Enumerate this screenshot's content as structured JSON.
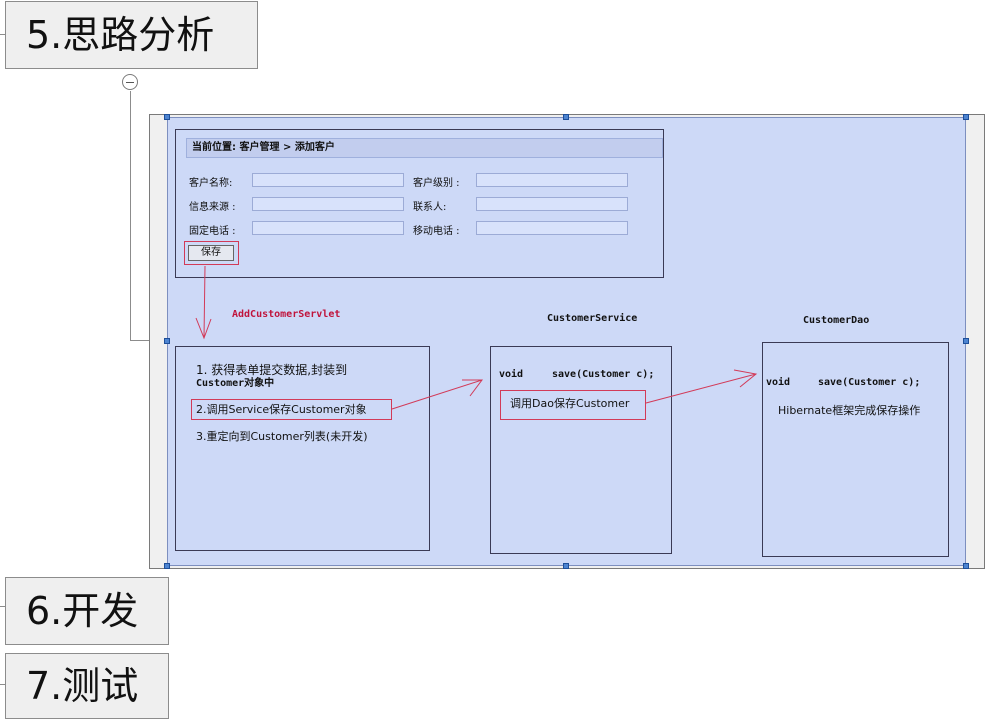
{
  "topics": {
    "t5": "5.思路分析",
    "t6": "6.开发",
    "t7": "7.测试"
  },
  "form": {
    "breadcrumb": "当前位置: 客户管理 > 添加客户",
    "labels": {
      "cust_name": "客户名称:",
      "cust_level": "客户级别 :",
      "info_source": "信息来源 :",
      "contact": "联系人:",
      "fixed_phone": "固定电话 :",
      "mobile_phone": "移动电话 :"
    },
    "save_label": "保存"
  },
  "servlet": {
    "name": "AddCustomerServlet",
    "step1_line1": "1. 获得表单提交数据,封装到",
    "step1_line2": "Customer对象中",
    "step2": "2.调用Service保存Customer对象",
    "step3": "3.重定向到Customer列表(未开发)"
  },
  "service": {
    "name": "CustomerService",
    "kw_void": "void",
    "method": "save(Customer c);",
    "call": "调用Dao保存Customer"
  },
  "dao": {
    "name": "CustomerDao",
    "kw_void": "void",
    "method": "save(Customer c);",
    "desc": "Hibernate框架完成保存操作"
  },
  "colors": {
    "image_bg": "#cdd9f7",
    "highlight_red": "#d23a58",
    "code_red": "#c0143c"
  }
}
